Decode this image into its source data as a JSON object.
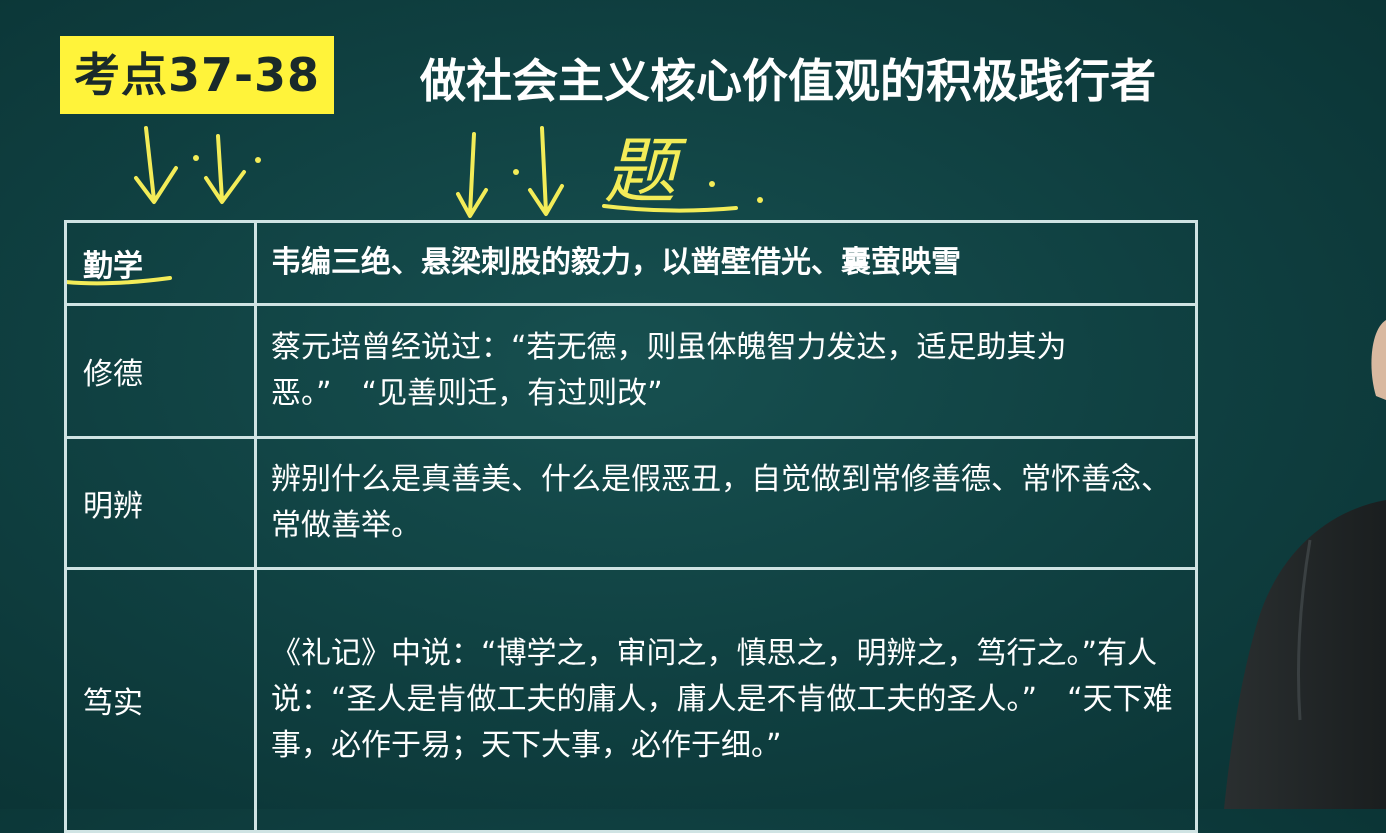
{
  "badge": {
    "text": "考点37-38",
    "color": "#fff33a"
  },
  "title": "做社会主义核心价值观的积极践行者",
  "handwriting": {
    "character": "题",
    "ink_color": "#f3ec58"
  },
  "table": {
    "border_color": "#cfe3e3",
    "rows": [
      {
        "term": "勤学",
        "text": "韦编三绝、悬梁刺股的毅力，以凿壁借光、囊萤映雪"
      },
      {
        "term": "修德",
        "text": "蔡元培曾经说过：“若无德，则虽体魄智力发达，适足助其为恶。”　“见善则迁，有过则改”"
      },
      {
        "term": "明辨",
        "text": "辨别什么是真善美、什么是假恶丑，自觉做到常修善德、常怀善念、常做善举。"
      },
      {
        "term": "笃实",
        "text": "《礼记》中说：“博学之，审问之，慎思之，明辨之，笃行之。”有人说：“圣人是肯做工夫的庸人，庸人是不肯做工夫的圣人。”　“天下难事，必作于易；天下大事，必作于细。”"
      }
    ]
  },
  "colors": {
    "board_background": "#0f3f40",
    "text": "#ffffff"
  }
}
